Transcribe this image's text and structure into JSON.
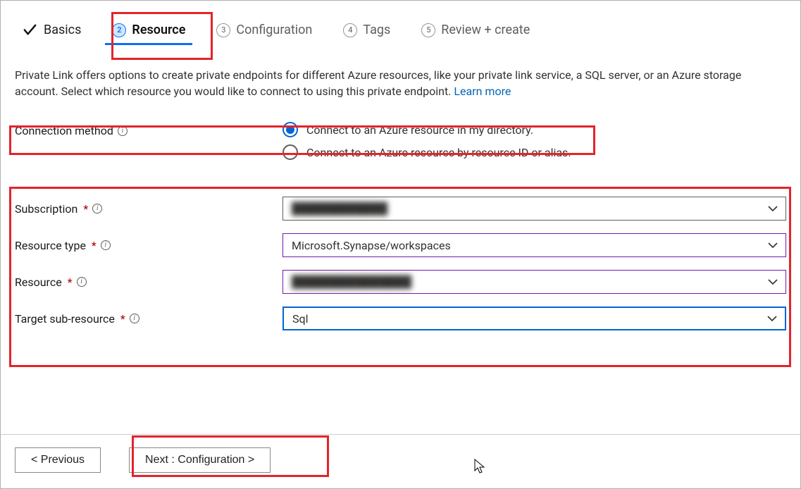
{
  "tabs": {
    "basics": {
      "label": "Basics"
    },
    "resource": {
      "num": "2",
      "label": "Resource"
    },
    "config": {
      "num": "3",
      "label": "Configuration"
    },
    "tags": {
      "num": "4",
      "label": "Tags"
    },
    "review": {
      "num": "5",
      "label": "Review + create"
    }
  },
  "description": {
    "text": "Private Link offers options to create private endpoints for different Azure resources, like your private link service, a SQL server, or an Azure storage account. Select which resource you would like to connect to using this private endpoint.  ",
    "learnMore": "Learn more"
  },
  "fields": {
    "connectionMethod": {
      "label": "Connection method",
      "option1": "Connect to an Azure resource in my directory.",
      "option2": "Connect to an Azure resource by resource ID or alias."
    },
    "subscription": {
      "label": "Subscription",
      "value": "████████████"
    },
    "resourceType": {
      "label": "Resource type",
      "value": "Microsoft.Synapse/workspaces"
    },
    "resource": {
      "label": "Resource",
      "value": "███████████████"
    },
    "targetSubResource": {
      "label": "Target sub-resource",
      "value": "Sql"
    }
  },
  "footer": {
    "previous": "< Previous",
    "next": "Next : Configuration >"
  }
}
